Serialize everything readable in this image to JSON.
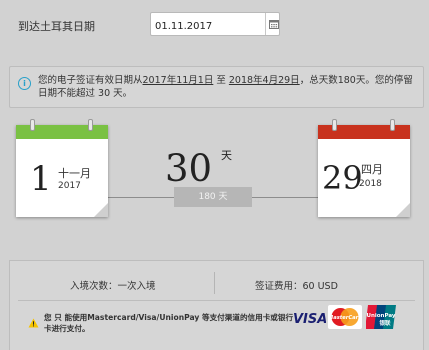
{
  "arrival": {
    "label": "到达土耳其日期",
    "date_value": "01.11.2017"
  },
  "info": {
    "text_before": "您的电子签证有效日期从",
    "start_date": "2017年11月1日",
    "text_to": " 至 ",
    "end_date": "2018年4月29日",
    "text_after": "，总天数180天。您的停留日期不能超过 30 天。"
  },
  "calendar_start": {
    "day": "1",
    "month": "十一月",
    "year": "2017",
    "head_color": "#7ac143"
  },
  "calendar_end": {
    "day": "29",
    "month": "四月",
    "year": "2018",
    "head_color": "#c8321e"
  },
  "stay": {
    "days": "30",
    "unit": "天",
    "total_badge": "180 天"
  },
  "visa": {
    "entries": "入境次数：一次入境",
    "fee": "签证费用：60 USD",
    "payment_note": "您 只 能使用Mastercard/Visa/UnionPay 等支付渠道的信用卡或银行卡进行支付。"
  },
  "payment_logos": {
    "visa": "VISA",
    "mastercard": "MasterCard",
    "unionpay_en": "UnionPay",
    "unionpay_cn": "银联"
  },
  "icons": {
    "calendar": "calendar-icon",
    "info": "info-icon",
    "warning": "warning-icon"
  }
}
